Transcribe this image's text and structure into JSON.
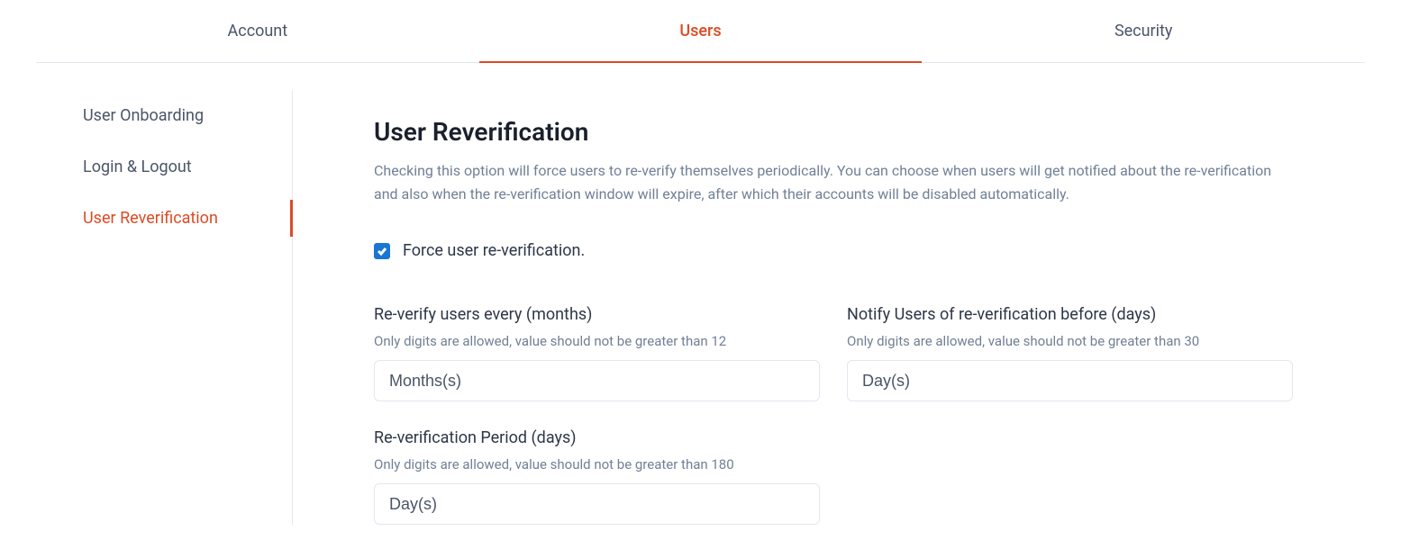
{
  "topTabs": {
    "account": "Account",
    "users": "Users",
    "security": "Security"
  },
  "sidebar": {
    "items": [
      {
        "label": "User Onboarding"
      },
      {
        "label": "Login & Logout"
      },
      {
        "label": "User Reverification"
      }
    ]
  },
  "section": {
    "title": "User Reverification",
    "desc": "Checking this option will force users to re-verify themselves periodically. You can choose when users will get notified about the re-verification and also when the re-verification window will expire, after which their accounts will be disabled automatically."
  },
  "checkbox": {
    "label": "Force user re-verification.",
    "checked": true
  },
  "fields": {
    "reverifyEvery": {
      "label": "Re-verify users every (months)",
      "help": "Only digits are allowed, value should not be greater than 12",
      "placeholder": "Months(s)"
    },
    "notifyBefore": {
      "label": "Notify Users of re-verification before (days)",
      "help": "Only digits are allowed, value should not be greater than 30",
      "placeholder": "Day(s)"
    },
    "reverifyPeriod": {
      "label": "Re-verification Period (days)",
      "help": "Only digits are allowed, value should not be greater than 180",
      "placeholder": "Day(s)"
    }
  }
}
